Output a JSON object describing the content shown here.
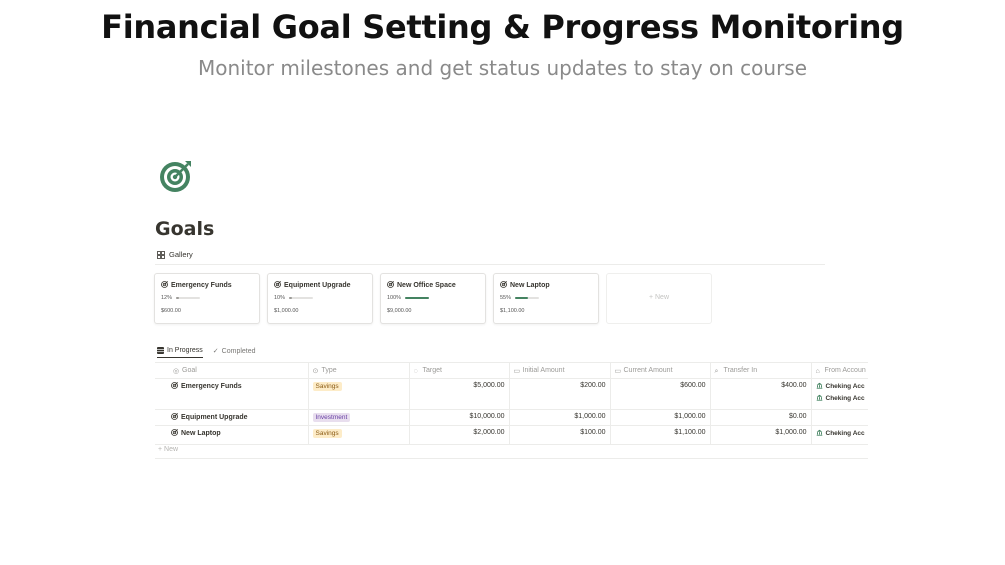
{
  "hero": {
    "title": "Financial Goal Setting & Progress Monitoring",
    "subtitle": "Monitor milestones and get status updates to stay on course"
  },
  "page": {
    "icon": "target-icon",
    "title": "Goals",
    "view_label": "Gallery"
  },
  "gallery": {
    "cards": [
      {
        "title": "Emergency Funds",
        "progress_label": "12%",
        "progress": 0.12,
        "amount": "$600.00"
      },
      {
        "title": "Equipment Upgrade",
        "progress_label": "10%",
        "progress": 0.1,
        "amount": "$1,000.00"
      },
      {
        "title": "New Office Space",
        "progress_label": "100%",
        "progress": 1.0,
        "amount": "$9,000.00"
      },
      {
        "title": "New Laptop",
        "progress_label": "55%",
        "progress": 0.55,
        "amount": "$1,100.00"
      }
    ],
    "new_label": "+ New"
  },
  "tabs": [
    {
      "label": "In Progress",
      "active": true
    },
    {
      "label": "Completed",
      "active": false
    }
  ],
  "table": {
    "columns": [
      "Goal",
      "Type",
      "Target",
      "Initial Amount",
      "Current Amount",
      "Transfer In",
      "From Accoun"
    ],
    "rows": [
      {
        "goal": "Emergency Funds",
        "type": "Savings",
        "target": "$5,000.00",
        "initial": "$200.00",
        "current": "$600.00",
        "transfer": "$400.00",
        "accounts": [
          "Cheking Acc",
          "Cheking Acc"
        ]
      },
      {
        "goal": "Equipment Upgrade",
        "type": "Investment",
        "target": "$10,000.00",
        "initial": "$1,000.00",
        "current": "$1,000.00",
        "transfer": "$0.00",
        "accounts": []
      },
      {
        "goal": "New Laptop",
        "type": "Savings",
        "target": "$2,000.00",
        "initial": "$100.00",
        "current": "$1,100.00",
        "transfer": "$1,000.00",
        "accounts": [
          "Cheking Acc"
        ]
      }
    ],
    "new_label": "+ New"
  },
  "colors": {
    "savings_bg": "#fdecc8",
    "savings_fg": "#8a5a14",
    "investment_bg": "#e8deee",
    "investment_fg": "#6940a5",
    "accent_green": "#448361"
  }
}
